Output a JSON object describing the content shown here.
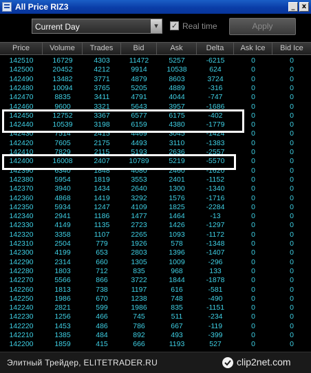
{
  "window": {
    "title": "All Price RIZ3",
    "minimize": "_",
    "close": "x"
  },
  "toolbar": {
    "period_value": "Current Day",
    "realtime_checked": true,
    "realtime_label": "Real time",
    "apply_label": "Apply"
  },
  "columns": [
    "Price",
    "Volume",
    "Trades",
    "Bid",
    "Ask",
    "Delta",
    "Ask Ice",
    "Bid Ice"
  ],
  "rows": [
    [
      "142510",
      "16729",
      "4303",
      "11472",
      "5257",
      "-6215",
      "0",
      "0"
    ],
    [
      "142500",
      "20452",
      "4212",
      "9914",
      "10538",
      "624",
      "0",
      "0"
    ],
    [
      "142490",
      "13482",
      "3771",
      "4879",
      "8603",
      "3724",
      "0",
      "0"
    ],
    [
      "142480",
      "10094",
      "3765",
      "5205",
      "4889",
      "-316",
      "0",
      "0"
    ],
    [
      "142470",
      "8835",
      "3411",
      "4791",
      "4044",
      "-747",
      "0",
      "0"
    ],
    [
      "142460",
      "9600",
      "3321",
      "5643",
      "3957",
      "-1686",
      "0",
      "0"
    ],
    [
      "142450",
      "12752",
      "3367",
      "6577",
      "6175",
      "-402",
      "0",
      "0"
    ],
    [
      "142440",
      "10539",
      "3198",
      "6159",
      "4380",
      "-1779",
      "0",
      "0"
    ],
    [
      "142430",
      "7514",
      "2415",
      "4469",
      "3045",
      "-1424",
      "0",
      "0"
    ],
    [
      "142420",
      "7605",
      "2175",
      "4493",
      "3110",
      "-1383",
      "0",
      "0"
    ],
    [
      "142410",
      "7829",
      "2115",
      "5193",
      "2636",
      "-2557",
      "0",
      "0"
    ],
    [
      "142400",
      "16008",
      "2407",
      "10789",
      "5219",
      "-5570",
      "0",
      "0"
    ],
    [
      "142390",
      "6340",
      "1848",
      "4080",
      "2460",
      "-1620",
      "0",
      "0"
    ],
    [
      "142380",
      "5954",
      "1819",
      "3553",
      "2401",
      "-1152",
      "0",
      "0"
    ],
    [
      "142370",
      "3940",
      "1434",
      "2640",
      "1300",
      "-1340",
      "0",
      "0"
    ],
    [
      "142360",
      "4868",
      "1419",
      "3292",
      "1576",
      "-1716",
      "0",
      "0"
    ],
    [
      "142350",
      "5934",
      "1247",
      "4109",
      "1825",
      "-2284",
      "0",
      "0"
    ],
    [
      "142340",
      "2941",
      "1186",
      "1477",
      "1464",
      "-13",
      "0",
      "0"
    ],
    [
      "142330",
      "4149",
      "1135",
      "2723",
      "1426",
      "-1297",
      "0",
      "0"
    ],
    [
      "142320",
      "3358",
      "1107",
      "2265",
      "1093",
      "-1172",
      "0",
      "0"
    ],
    [
      "142310",
      "2504",
      "779",
      "1926",
      "578",
      "-1348",
      "0",
      "0"
    ],
    [
      "142300",
      "4199",
      "653",
      "2803",
      "1396",
      "-1407",
      "0",
      "0"
    ],
    [
      "142290",
      "2314",
      "660",
      "1305",
      "1009",
      "-296",
      "0",
      "0"
    ],
    [
      "142280",
      "1803",
      "712",
      "835",
      "968",
      "133",
      "0",
      "0"
    ],
    [
      "142270",
      "5566",
      "866",
      "3722",
      "1844",
      "-1878",
      "0",
      "0"
    ],
    [
      "142260",
      "1813",
      "738",
      "1197",
      "616",
      "-581",
      "0",
      "0"
    ],
    [
      "142250",
      "1986",
      "670",
      "1238",
      "748",
      "-490",
      "0",
      "0"
    ],
    [
      "142240",
      "2821",
      "599",
      "1986",
      "835",
      "-1151",
      "0",
      "0"
    ],
    [
      "142230",
      "1256",
      "466",
      "745",
      "511",
      "-234",
      "0",
      "0"
    ],
    [
      "142220",
      "1453",
      "486",
      "786",
      "667",
      "-119",
      "0",
      "0"
    ],
    [
      "142210",
      "1385",
      "484",
      "892",
      "493",
      "-399",
      "0",
      "0"
    ],
    [
      "142200",
      "1859",
      "415",
      "666",
      "1193",
      "527",
      "0",
      "0"
    ]
  ],
  "footer": {
    "caption": "Элитный Трейдер, ELITETRADER.RU",
    "logo_text": "clip2net.com"
  },
  "colors": {
    "cell_text": "#3fd1e6",
    "highlight_border": "#ffffff",
    "titlebar": "#0a3da8"
  }
}
